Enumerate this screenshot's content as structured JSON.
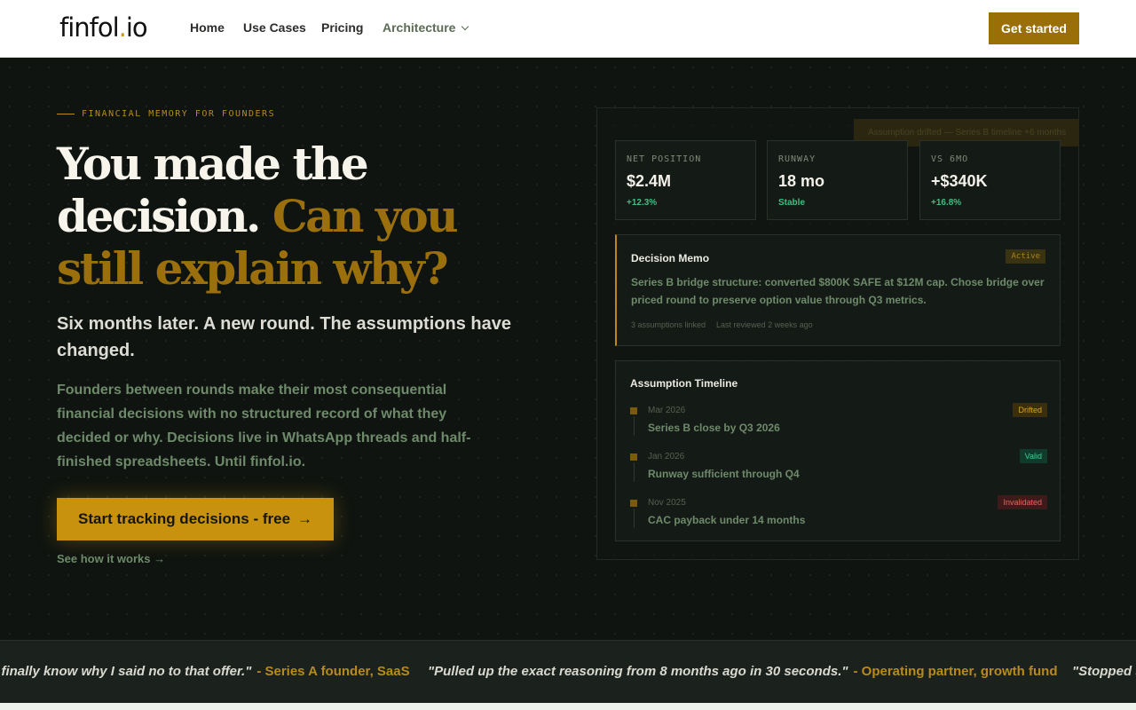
{
  "nav": {
    "logo_main": "finfol",
    "logo_dot": ".",
    "logo_tld": "io",
    "links": [
      "Home",
      "Use Cases",
      "Pricing",
      "Architecture"
    ],
    "cta": "Get started"
  },
  "hero": {
    "eyebrow": "FINANCIAL MEMORY FOR FOUNDERS",
    "headline_a": "You made the decision.",
    "headline_b": "Can you still explain why?",
    "subhead": "Six months later. A new round. The assumptions have changed.",
    "body": "Founders between rounds make their most consequential financial decisions with no structured record of what they decided or why. Decisions live in WhatsApp threads and half-finished spreadsheets. Until finfol.io.",
    "cta": "Start tracking decisions - free",
    "cta_arrow": "→",
    "secondary": "See how it works",
    "secondary_arrow": "→"
  },
  "panel": {
    "toast": "Assumption drifted — Series B timeline +6 months",
    "stats": [
      {
        "label": "NET POSITION",
        "value": "$2.4M",
        "delta": "+12.3%"
      },
      {
        "label": "RUNWAY",
        "value": "18 mo",
        "delta": "Stable"
      },
      {
        "label": "VS 6MO",
        "value": "+$340K",
        "delta": "+16.8%"
      }
    ],
    "memo": {
      "title": "Decision Memo",
      "badge": "Active",
      "body": "Series B bridge structure: converted $800K SAFE at $12M cap. Chose bridge over priced round to preserve option value through Q3 metrics.",
      "meta_a": "3 assumptions linked",
      "meta_b": "Last reviewed 2 weeks ago"
    },
    "timeline": {
      "title": "Assumption Timeline",
      "items": [
        {
          "date": "Mar 2026",
          "text": "Series B close by Q3 2026",
          "status": "Drifted"
        },
        {
          "date": "Jan 2026",
          "text": "Runway sufficient through Q4",
          "status": "Valid"
        },
        {
          "date": "Nov 2025",
          "text": "CAC payback under 14 months",
          "status": "Invalidated"
        }
      ]
    }
  },
  "testimonials": [
    {
      "quote": "\"I finally know why I said no to that offer.\"",
      "source": "- Series A founder, SaaS"
    },
    {
      "quote": "\"Pulled up the exact reasoning from 8 months ago in 30 seconds.\"",
      "source": "- Operating partner, growth fund"
    },
    {
      "quote": "\"Stopped s",
      "source": ""
    }
  ],
  "colors": {
    "accent": "#c9920e",
    "gold_text": "#9a6f0c",
    "valid": "#3fcf94",
    "invalidated": "#e06a62"
  }
}
